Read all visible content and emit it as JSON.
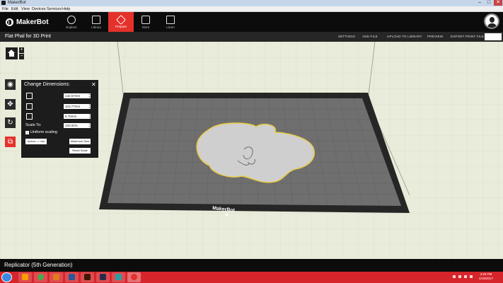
{
  "window": {
    "title": "MakerBot",
    "controls": [
      "–",
      "□",
      "✕"
    ]
  },
  "menubar": [
    "File",
    "Edit",
    "View",
    "Devices",
    "Services",
    "Help"
  ],
  "brand": {
    "logo_text": "MakerBot"
  },
  "nav": {
    "tabs": [
      {
        "label": "Explore",
        "icon": "compass-icon"
      },
      {
        "label": "Library",
        "icon": "library-icon"
      },
      {
        "label": "Prepare",
        "icon": "prepare-icon",
        "active": true
      },
      {
        "label": "Store",
        "icon": "store-icon"
      },
      {
        "label": "Learn",
        "icon": "learn-icon"
      }
    ]
  },
  "subheader": {
    "filename": "Flat Phal for 3D Print",
    "actions": [
      "SETTINGS",
      "ADD FILE",
      "UPLOAD TO LIBRARY",
      "PREVIEW",
      "EXPORT PRINT FILE"
    ],
    "print_label": ""
  },
  "tools": [
    {
      "name": "view-tool",
      "icon": "eye-icon"
    },
    {
      "name": "move-tool",
      "icon": "move-icon"
    },
    {
      "name": "rotate-tool",
      "icon": "rotate-icon"
    },
    {
      "name": "scale-tool",
      "icon": "scale-icon",
      "active": true
    }
  ],
  "zoom": {
    "in": "+",
    "out": "−"
  },
  "dimensions_panel": {
    "title": "Change Dimensions:",
    "close": "✕",
    "x_value": "142.57mm",
    "y_value": "103.77mm",
    "z_value": "6.76mm",
    "scale_label": "Scale To:",
    "scale_value": "100.00%",
    "uniform_label": "Uniform scaling",
    "uniform_checked": "✓",
    "units_button": "Inches -> mm",
    "max_size_button": "Maximum Size",
    "reset_button": "Reset Scale"
  },
  "plate": {
    "brand_text": "MakerBot"
  },
  "status": {
    "printer": "Replicator (5th Generation)"
  },
  "taskbar": {
    "time": "3:28 PM",
    "date": "4/19/2017"
  },
  "colors": {
    "accent": "#e5312b",
    "background": "#e9ecda",
    "plate": "#6e6e6e",
    "model": "#cfcfcf",
    "model_outline": "#e8c93a"
  }
}
